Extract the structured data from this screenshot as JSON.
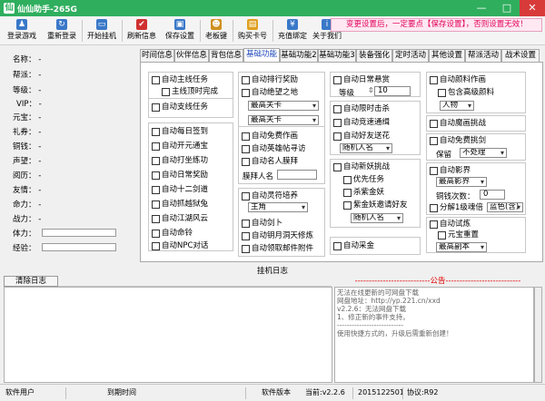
{
  "window": {
    "title": "仙仙助手-265G",
    "minimize": "—",
    "maximize": "□",
    "close": "✕",
    "accent": "#2fae5e"
  },
  "toolbar": {
    "items": [
      {
        "label": "登录游戏",
        "icon": "user-icon",
        "color": "#3a78c8"
      },
      {
        "label": "重新登录",
        "icon": "refresh-user-icon",
        "color": "#3a78c8"
      },
      {
        "label": "开始挂机",
        "icon": "computer-icon",
        "color": "#3a78c8"
      },
      {
        "label": "刷新信息",
        "icon": "check-icon",
        "color": "#d03030"
      },
      {
        "label": "保存设置",
        "icon": "save-icon",
        "color": "#3a78c8"
      },
      {
        "label": "老板键",
        "icon": "boss-key-icon",
        "color": "#d09020"
      },
      {
        "label": "购买卡号",
        "icon": "card-icon",
        "color": "#e0a020"
      },
      {
        "label": "充值绑定",
        "icon": "recharge-icon",
        "color": "#3a78c8"
      },
      {
        "label": "关于我们",
        "icon": "info-icon",
        "color": "#3a78c8"
      }
    ]
  },
  "notice": "变更设置后，一定要点【保存设置】，否则设置无效！",
  "left_info": {
    "rows": [
      {
        "label": "名称：",
        "value": "-"
      },
      {
        "label": "帮派：",
        "value": "-"
      },
      {
        "label": "等级：",
        "value": "-"
      },
      {
        "label": "VIP：",
        "value": "-"
      },
      {
        "label": "元宝：",
        "value": "-"
      },
      {
        "label": "礼券：",
        "value": "-"
      },
      {
        "label": "铜钱：",
        "value": "-"
      },
      {
        "label": "声望：",
        "value": "-"
      },
      {
        "label": "阅历：",
        "value": "-"
      },
      {
        "label": "友情：",
        "value": "-"
      },
      {
        "label": "命力：",
        "value": "-"
      },
      {
        "label": "战力：",
        "value": "-"
      }
    ],
    "stamina_label": "体力：",
    "exp_label": "经验："
  },
  "tabs": [
    "时间信息",
    "伙伴信息",
    "背包信息",
    "基础功能",
    "基础功能2",
    "基础功能3",
    "装备强化",
    "定时活动",
    "其他设置",
    "帮派活动",
    "战术设置"
  ],
  "active_tab": 3,
  "panel": {
    "col1": {
      "auto_main": "自动主线任务",
      "main_finish": "主线顶时完成",
      "auto_branch": "自动支线任务",
      "auto_signin": "自动每日签到",
      "auto_open_box": "自动开元通宝",
      "auto_train": "自动打坐练功",
      "auto_daily_reward": "自动日常奖励",
      "auto_12_swords": "自动十二剑道",
      "auto_rob": "自动抓越狱兔",
      "auto_jianghu": "自动江湖风云",
      "auto_fortune": "自动命铃",
      "auto_npc": "自动NPC对话"
    },
    "col2": {
      "auto_rank": "自动排行奖励",
      "auto_absolute": "自动绝望之地",
      "sel_a": "最高关卡",
      "sel_b": "最高关卡",
      "auto_free_work": "自动免费作画",
      "auto_hero_post": "自动英雄帖寻访",
      "auto_celebrity": "自动名人膜拜",
      "worship_label": "膜拜人名",
      "spirit_title": "自动灵符培养",
      "spirit_sel": "主角",
      "auto_sword": "自动剑卜",
      "auto_moon": "自动钥月洞天修炼",
      "auto_mail": "自动领取邮件附件"
    },
    "col3": {
      "auto_daily_quest": "自动日常悬赏",
      "level_label": "等级",
      "level_value": "10",
      "auto_limit_kill": "自动限时击杀",
      "auto_dart": "自动竞速通缉",
      "auto_friend_flower": "自动好友送花",
      "friend_sel": "随机人名",
      "auto_new_demon": "自动新妖挑战",
      "prior_task": "优先任务",
      "kill_gold_demon": "杀紫金妖",
      "invite_friend": "紫金妖邀请好友",
      "invite_sel": "随机人名",
      "auto_collect": "自动采金"
    },
    "col4": {
      "auto_material": "自动颜料作画",
      "include_advanced": "包含高级颜料",
      "material_sel": "人物",
      "auto_devil": "自动魔画挑战",
      "auto_free_duel": "自动免费挑剑",
      "keep_label": "保留",
      "keep_sel": "不处理",
      "auto_shadow": "自动影界",
      "shadow_sel": "最高影界",
      "copper_label": "铜钱次数：",
      "copper_value": "0",
      "decompose_label": "分解1级魂倍",
      "decompose_sel": "蓝色(含)",
      "auto_trial": "自动试炼",
      "yuanbao_reset": "元宝重置",
      "trial_sel": "最高副本"
    }
  },
  "log": {
    "title": "挂机日志",
    "clear_button": "清除日志"
  },
  "announcement": {
    "title": "---------------------------公告---------------------------",
    "lines": [
      "无法在线更新的可网盘下载",
      "网盘地址：http://yp.221.cn/xxd",
      "v2.2.6：无法网盘下载",
      "1、修正新的事件支持。",
      "---------------------------",
      "使用快捷方式的，升级后需重新创建！"
    ]
  },
  "status": {
    "user_label": "软件用户",
    "expire_label": "到期时间",
    "version_label": "软件版本",
    "current_version": "当前:v2.2.6",
    "date": "2015122501",
    "protocol": "协议:R92"
  }
}
